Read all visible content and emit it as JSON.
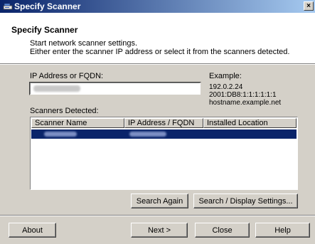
{
  "window": {
    "title": "Specify Scanner",
    "close_glyph": "×"
  },
  "header": {
    "title": "Specify Scanner",
    "line1": "Start network scanner settings.",
    "line2": "Either enter the scanner IP address or select it from the scanners detected."
  },
  "form": {
    "ip_label": "IP Address or FQDN:",
    "example_title": "Example:",
    "example_lines": [
      "192.0.2.24",
      "2001:DB8:1:1:1:1:1:1",
      "hostname.example.net"
    ],
    "detected_label": "Scanners Detected:"
  },
  "table": {
    "columns": [
      "Scanner Name",
      "IP Address / FQDN",
      "Installed Location"
    ]
  },
  "buttons": {
    "search_again": "Search Again",
    "search_display": "Search / Display Settings...",
    "about": "About",
    "next": "Next >",
    "close": "Close",
    "help": "Help"
  },
  "colors": {
    "titlebar_start": "#0a246a",
    "titlebar_end": "#a6caf0",
    "selection": "#0a246a",
    "face": "#d4d0c8"
  }
}
